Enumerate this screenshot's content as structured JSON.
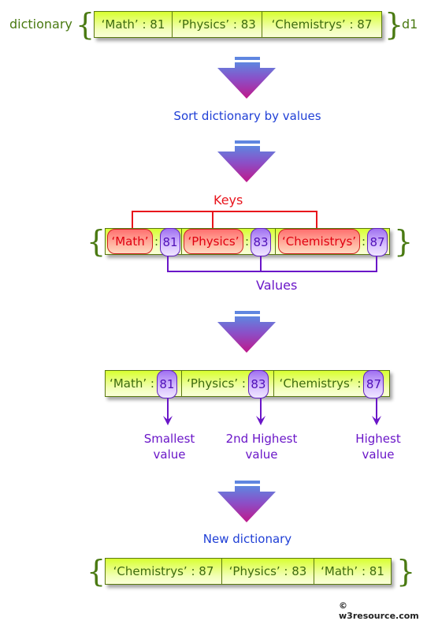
{
  "row1": {
    "left_label": "dictionary",
    "right_label": "d1",
    "items": [
      "‘Math’ : 81",
      "‘Physics’ : 83",
      "‘Chemistrys’ : 87"
    ]
  },
  "step1_label": "Sort dictionary by values",
  "row2": {
    "keys_label": "Keys",
    "values_label": "Values",
    "pairs": [
      {
        "key": "‘Math’",
        "value": "81"
      },
      {
        "key": "‘Physics’",
        "value": "83"
      },
      {
        "key": "‘Chemistrys’",
        "value": "87"
      }
    ],
    "colon": ":"
  },
  "row3": {
    "pairs": [
      {
        "key": "‘Math’ :",
        "value": "81",
        "annotation_1": "Smallest",
        "annotation_2": "value"
      },
      {
        "key": "‘Physics’ :",
        "value": "83",
        "annotation_1": "2nd Highest",
        "annotation_2": "value"
      },
      {
        "key": "‘Chemistrys’ :",
        "value": "87",
        "annotation_1": "Highest",
        "annotation_2": "value"
      }
    ]
  },
  "step2_label": "New dictionary",
  "row4": {
    "items": [
      "‘Chemistrys’ : 87",
      "‘Physics’ : 83",
      "‘Math’ : 81"
    ]
  },
  "braces": {
    "open": "{",
    "close": "}"
  },
  "copyright": "© w3resource.com",
  "colors": {
    "dict_green": "#d8ff30",
    "key_red": "#e8141c",
    "value_purple": "#6a16c8",
    "label_blue": "#1f3fd6"
  }
}
